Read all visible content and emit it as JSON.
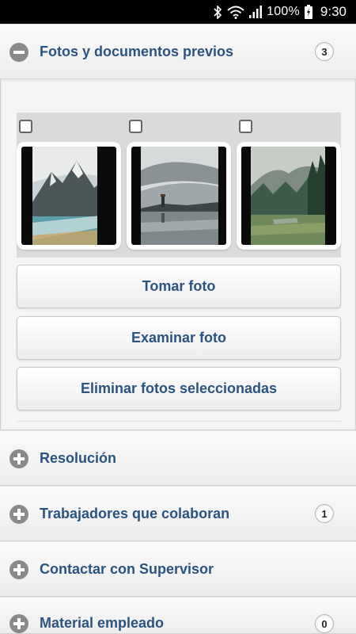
{
  "status_bar": {
    "battery_percent": "100%",
    "time": "9:30",
    "icons": [
      "bluetooth-icon",
      "wifi-icon",
      "signal-icon",
      "battery-icon"
    ]
  },
  "sections": [
    {
      "title": "Fotos y documentos previos",
      "count": "3",
      "expanded": true
    },
    {
      "title": "Resolución",
      "count": null,
      "expanded": false
    },
    {
      "title": "Trabajadores que colaboran",
      "count": "1",
      "expanded": false
    },
    {
      "title": "Contactar con Supervisor",
      "count": null,
      "expanded": false
    },
    {
      "title": "Material empleado",
      "count": "0",
      "expanded": false
    }
  ],
  "photos": {
    "items": [
      {
        "checked": false,
        "thumbnail": "mountain-lake-photo"
      },
      {
        "checked": false,
        "thumbnail": "lighthouse-sea-photo"
      },
      {
        "checked": false,
        "thumbnail": "forest-meadow-photo"
      }
    ],
    "buttons": {
      "take_photo": "Tomar foto",
      "browse_photo": "Examinar foto",
      "delete_selected": "Eliminar fotos seleccionadas"
    }
  },
  "colors": {
    "accent_text": "#2a5480",
    "icon_gray": "#8a8a8a",
    "status_bar": "#000000"
  }
}
